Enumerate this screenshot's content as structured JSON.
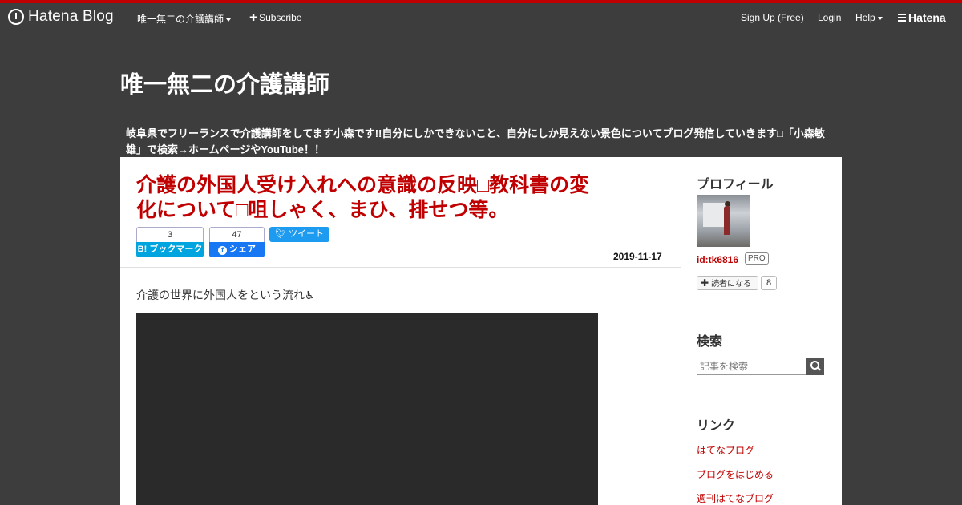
{
  "topbar": {
    "logo": "Hatena Blog",
    "blog_menu": "唯一無二の介護講師",
    "subscribe": "Subscribe",
    "signup": "Sign Up (Free)",
    "login": "Login",
    "help": "Help",
    "brand": "Hatena",
    "accent_color": "#c00000"
  },
  "blog": {
    "title": "唯一無二の介護講師",
    "description": "岐阜県でフリーランスで介護講師をしてます小森です!!自分にしかできないこと、自分にしか見えない景色についてブログ発信していきます□「小森敏雄」で検索→ホームページやYouTube！！"
  },
  "entry": {
    "title": "介護の外国人受け入れへの意識の反映□教科書の変化について□咀しゃく、まひ、排せつ等。",
    "bookmark_count": "3",
    "bookmark_label": "B! ブックマーク",
    "fb_count": "47",
    "fb_label": "シェア",
    "tweet_label": "ツイート",
    "date": "2019-11-17",
    "body_text": "介護の世界に外国人をという流れ♿"
  },
  "sidebar": {
    "profile_heading": "プロフィール",
    "profile_id": "id:tk6816",
    "pro_badge": "PRO",
    "reader_label": "読者になる",
    "reader_count": "8",
    "search_heading": "検索",
    "search_placeholder": "記事を検索",
    "links_heading": "リンク",
    "links": [
      "はてなブログ",
      "ブログをはじめる",
      "週刊はてなブログ"
    ]
  }
}
